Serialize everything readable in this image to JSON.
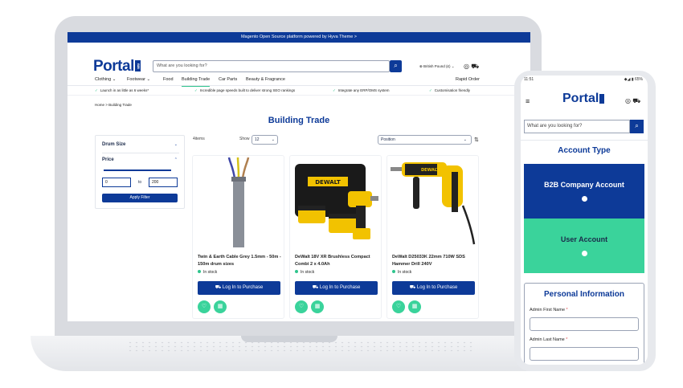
{
  "laptop": {
    "announcement": "Magento Open Source platform powered by Hyva Theme >",
    "logo": "Portal",
    "search_placeholder": "What are you looking for?",
    "currency": "British Pound (£)",
    "nav": [
      "Clothing",
      "Footwear",
      "Food",
      "Building Trade",
      "Car Parts",
      "Beauty & Fragrance",
      "Rapid Order"
    ],
    "nav_active": "Building Trade",
    "usps": [
      "Launch in as little as 6 weeks*",
      "Incredible page speeds built to deliver strong SEO rankings",
      "Integrate any ERP/OMS system",
      "Customisation friendly"
    ],
    "breadcrumb": [
      "Home",
      "Building Trade"
    ],
    "page_title": "Building Trade",
    "filters": {
      "drum_size": "Drum Size",
      "price": "Price",
      "min": "0",
      "to": "to",
      "max": "200",
      "apply": "Apply Filter"
    },
    "toolbar": {
      "count": "4items",
      "show_label": "Show",
      "show_value": "12",
      "sort": "Position"
    },
    "products": [
      {
        "name": "Twin & Earth Cable Grey 1.5mm - 50m - 150m drum sizes",
        "stock": "In stock",
        "button": "Log In to Purchase"
      },
      {
        "name": "DeWalt 18V XR Brushless Compact Combi 2 x 4.0Ah",
        "stock": "In stock",
        "button": "Log In to Purchase"
      },
      {
        "name": "DeWalt D25033K 22mm 710W SDS Hammer Drill 240V",
        "stock": "In stock",
        "button": "Log In to Purchase"
      }
    ]
  },
  "phone": {
    "time": "11:51",
    "status_right": "◆◢ ▮ 65%",
    "logo": "Portal",
    "search_placeholder": "What are you looking for?",
    "account_type_title": "Account Type",
    "b2b_option": "B2B Company Account",
    "user_option": "User Account",
    "personal_info_title": "Personal Information",
    "first_name_label": "Admin First Name",
    "last_name_label": "Admin Last Name",
    "required_mark": "*"
  },
  "colors": {
    "brand": "#0d3a98",
    "accent": "#3ad39b"
  }
}
